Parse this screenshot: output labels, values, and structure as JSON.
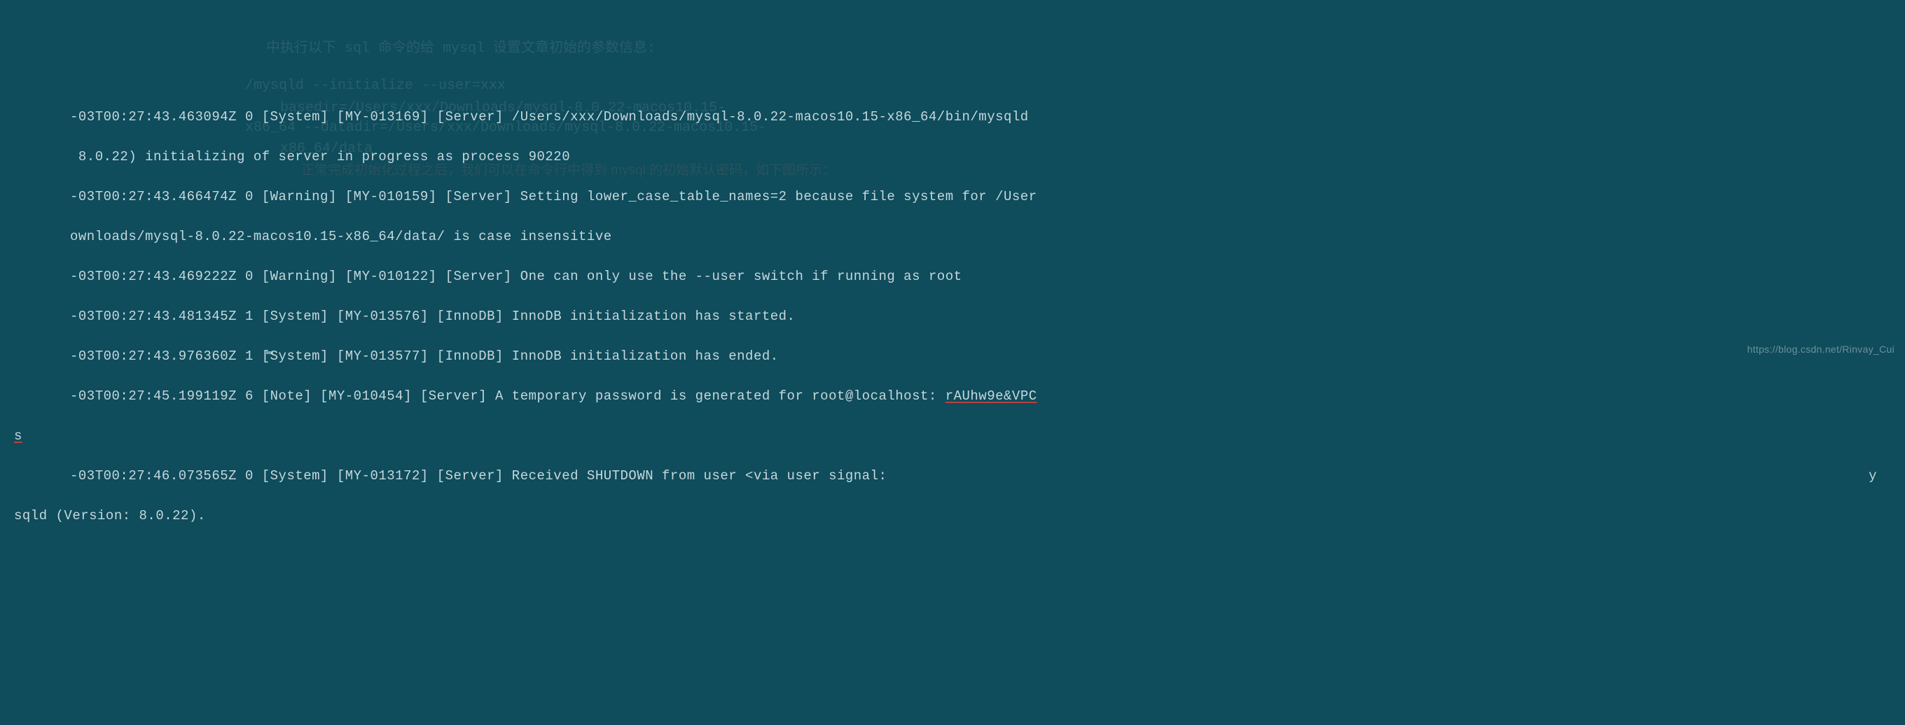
{
  "terminal": {
    "lines": [
      "-03T00:27:43.463094Z 0 [System] [MY-013169] [Server] /Users/xxx/Downloads/mysql-8.0.22-macos10.15-x86_64/bin/mysqld",
      " 8.0.22) initializing of server in progress as process 90220",
      "-03T00:27:43.466474Z 0 [Warning] [MY-010159] [Server] Setting lower_case_table_names=2 because file system for /User",
      "ownloads/mysql-8.0.22-macos10.15-x86_64/data/ is case insensitive",
      "-03T00:27:43.469222Z 0 [Warning] [MY-010122] [Server] One can only use the --user switch if running as root",
      "-03T00:27:43.481345Z 1 [System] [MY-013576] [InnoDB] InnoDB initialization has started.",
      "-03T00:27:43.976360Z 1 [System] [MY-013577] [InnoDB] InnoDB initialization has ended.",
      "-03T00:27:45.199119Z 6 [Note] [MY-010454] [Server] A temporary password is generated for root@localhost: ",
      "s",
      "-03T00:27:46.073565Z 0 [System] [MY-013172] [Server] Received SHUTDOWN from user <via user signal:",
      "sqld (Version: 8.0.22)."
    ],
    "temp_password": "rAUhw9e&VPC",
    "trailing_y": "y"
  },
  "ghost": {
    "g1": "中执行以下 sql 命令的给 mysql 设置文章初始的参数信息:",
    "g2": "/mysqld --initialize --user=xxx",
    "g3": "basedir=/Users/xxx/Downloads/mysql-8.0.22-macos10.15-",
    "g4": "x86_64 --datadir=/Users/xxx/Downloads/mysql-8.0.22-macos10.15-",
    "g5": "x86_64/data",
    "g6": "正常完成初始化过程之后，我们可以在命令行中得到 mysql 的初始默认密码，如下图所示："
  },
  "watermark": {
    "text": "https://blog.csdn.net/Rinvay_Cui"
  }
}
